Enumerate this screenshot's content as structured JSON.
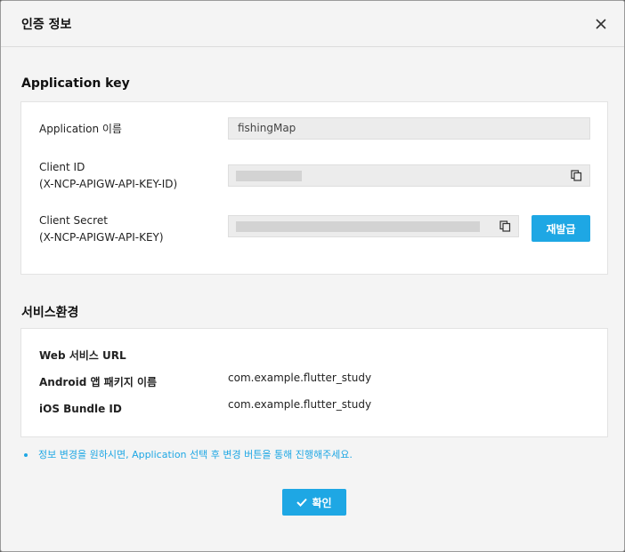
{
  "modal": {
    "title": "인증 정보",
    "close_icon": "close-icon"
  },
  "application_key": {
    "section_title": "Application key",
    "app_name_label": "Application 이름",
    "app_name_value": "fishingMap",
    "client_id_label_1": "Client ID",
    "client_id_label_2": "(X-NCP-APIGW-API-KEY-ID)",
    "client_secret_label_1": "Client Secret",
    "client_secret_label_2": "(X-NCP-APIGW-API-KEY)",
    "copy_icon": "copy-icon",
    "reissue_label": "재발급"
  },
  "service_env": {
    "section_title": "서비스환경",
    "web_url_label": "Web 서비스 URL",
    "android_label": "Android 앱 패키지 이름",
    "android_value": "com.example.flutter_study",
    "ios_label": "iOS Bundle ID",
    "ios_value": "com.example.flutter_study"
  },
  "note": "정보 변경을 원하시면, Application 선택 후 변경 버튼을 통해 진행해주세요.",
  "confirm_label": "확인",
  "colors": {
    "accent": "#1ea7e4",
    "background": "#f4f4f4"
  }
}
